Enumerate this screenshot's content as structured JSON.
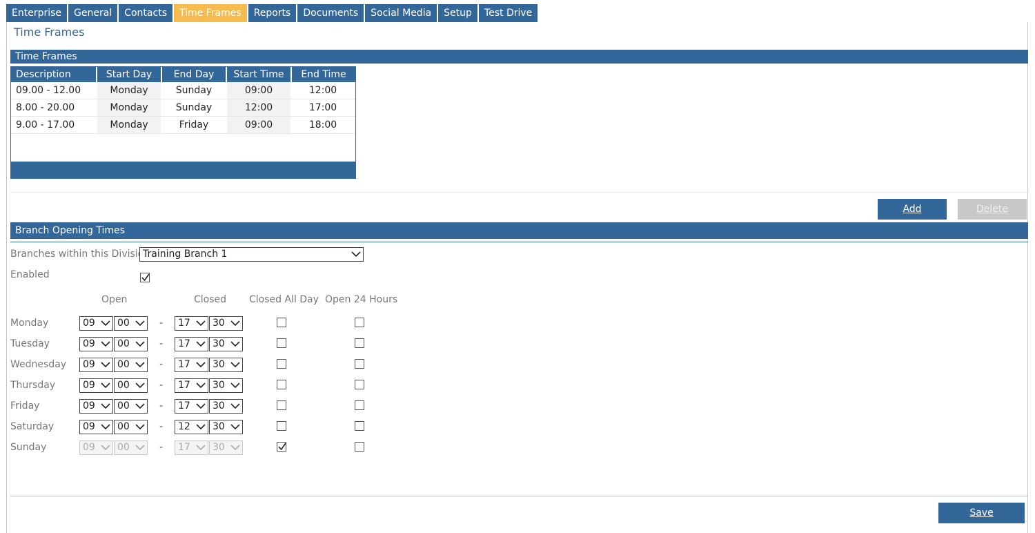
{
  "tabs": [
    {
      "label": "Enterprise",
      "active": false
    },
    {
      "label": "General",
      "active": false
    },
    {
      "label": "Contacts",
      "active": false
    },
    {
      "label": "Time Frames",
      "active": true
    },
    {
      "label": "Reports",
      "active": false
    },
    {
      "label": "Documents",
      "active": false
    },
    {
      "label": "Social Media",
      "active": false
    },
    {
      "label": "Setup",
      "active": false
    },
    {
      "label": "Test Drive",
      "active": false
    }
  ],
  "page_title": "Time Frames",
  "time_frames": {
    "section_title": "Time Frames",
    "columns": [
      "Description",
      "Start Day",
      "End Day",
      "Start Time",
      "End Time"
    ],
    "rows": [
      [
        "09.00 - 12.00",
        "Monday",
        "Sunday",
        "09:00",
        "12:00"
      ],
      [
        "8.00 - 20.00",
        "Monday",
        "Sunday",
        "12:00",
        "17:00"
      ],
      [
        "9.00 - 17.00",
        "Monday",
        "Friday",
        "09:00",
        "18:00"
      ]
    ]
  },
  "actions": {
    "add_label": "Add",
    "delete_label": "Delete"
  },
  "branch": {
    "section_title": "Branch Opening Times",
    "branch_label": "Branches within this Division",
    "branch_value": "Training Branch 1",
    "enabled_label": "Enabled",
    "enabled_checked": true,
    "col_open": "Open",
    "col_closed": "Closed",
    "col_closed_all_day": "Closed All Day",
    "col_open_24": "Open 24 Hours",
    "separator": "-",
    "days": [
      {
        "day": "Monday",
        "open_h": "09",
        "open_m": "00",
        "close_h": "17",
        "close_m": "30",
        "closed_all_day": false,
        "open_24": false,
        "disabled": false
      },
      {
        "day": "Tuesday",
        "open_h": "09",
        "open_m": "00",
        "close_h": "17",
        "close_m": "30",
        "closed_all_day": false,
        "open_24": false,
        "disabled": false
      },
      {
        "day": "Wednesday",
        "open_h": "09",
        "open_m": "00",
        "close_h": "17",
        "close_m": "30",
        "closed_all_day": false,
        "open_24": false,
        "disabled": false
      },
      {
        "day": "Thursday",
        "open_h": "09",
        "open_m": "00",
        "close_h": "17",
        "close_m": "30",
        "closed_all_day": false,
        "open_24": false,
        "disabled": false
      },
      {
        "day": "Friday",
        "open_h": "09",
        "open_m": "00",
        "close_h": "17",
        "close_m": "30",
        "closed_all_day": false,
        "open_24": false,
        "disabled": false
      },
      {
        "day": "Saturday",
        "open_h": "09",
        "open_m": "00",
        "close_h": "12",
        "close_m": "30",
        "closed_all_day": false,
        "open_24": false,
        "disabled": false
      },
      {
        "day": "Sunday",
        "open_h": "09",
        "open_m": "00",
        "close_h": "17",
        "close_m": "30",
        "closed_all_day": true,
        "open_24": false,
        "disabled": true
      }
    ]
  },
  "save_label": "Save",
  "colors": {
    "primary": "#336699",
    "active_tab": "#f5bb4e",
    "disabled": "#c8c8c8"
  }
}
